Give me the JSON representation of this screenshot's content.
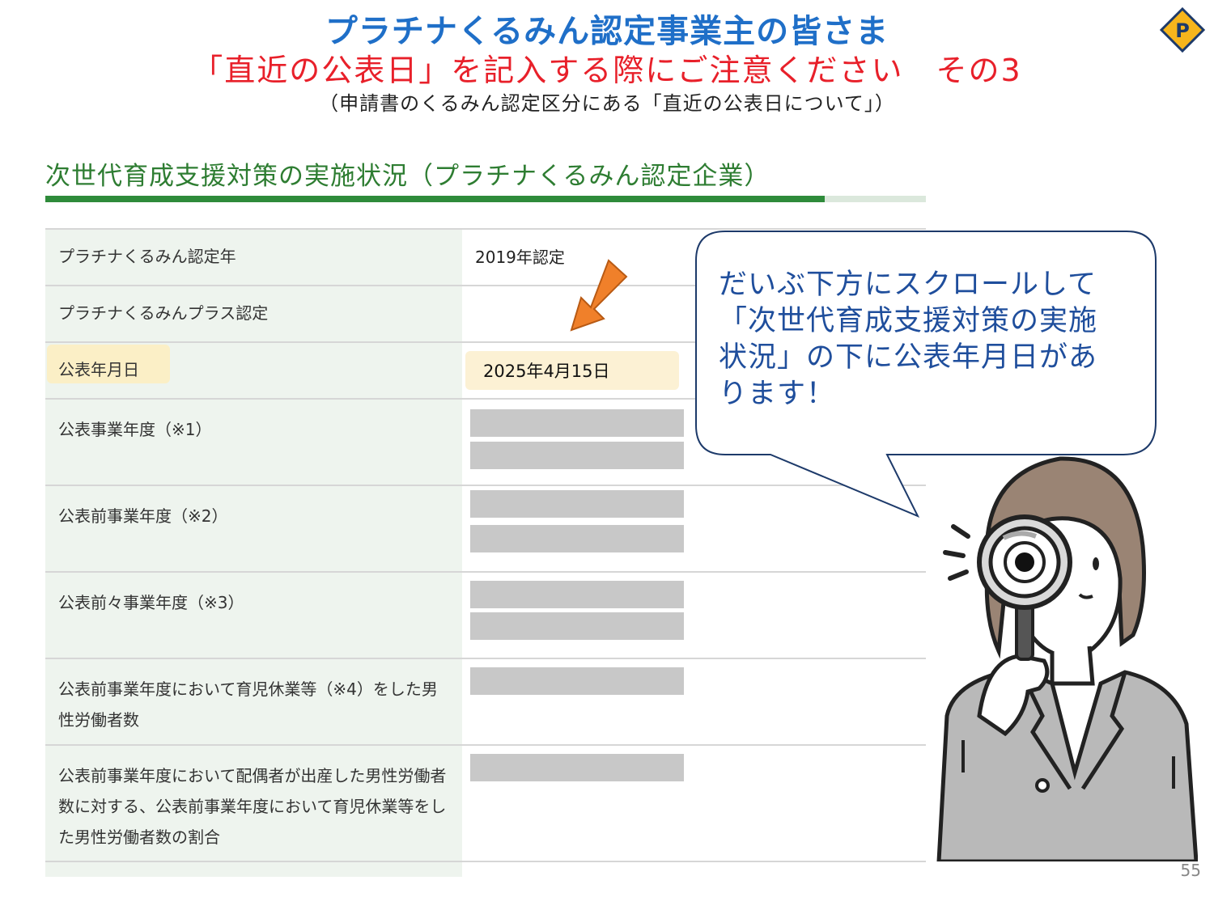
{
  "slide": {
    "title_line1": "プラチナくるみん認定事業主の皆さま",
    "title_line2": "「直近の公表日」を記入する際にご注意ください　その3",
    "title_line3": "（申請書のくるみん認定区分にある「直近の公表日について」）",
    "badge_letter": "P",
    "page_number": "55",
    "accent_blue": "#1f6fc8",
    "accent_red": "#e8202a"
  },
  "section": {
    "heading": "次世代育成支援対策の実施状況（プラチナくるみん認定企業）",
    "heading_color": "#2e7d32"
  },
  "table": {
    "rows": [
      {
        "label": "プラチナくるみん認定年",
        "value": "2019年認定"
      },
      {
        "label": "プラチナくるみんプラス認定",
        "value": ""
      },
      {
        "label": "公表年月日",
        "value": "2025年4月15日"
      },
      {
        "label": "公表事業年度（※1）",
        "value": ""
      },
      {
        "label": "公表前事業年度（※2）",
        "value": ""
      },
      {
        "label": "公表前々事業年度（※3）",
        "value": ""
      },
      {
        "label": "公表前事業年度において育児休業等（※4）をした男性労働者数",
        "value": ""
      },
      {
        "label": "公表前事業年度において配偶者が出産した男性労働者数に対する、公表前事業年度において育児休業等をした男性労働者数の割合",
        "value": ""
      }
    ]
  },
  "callout": {
    "text": "だいぶ下方にスクロールして「次世代育成支援対策の実施状況」の下に公表年月日があります！",
    "text_color": "#1f4e9c"
  },
  "icons": {
    "arrow": "orange-down-left-arrow-icon",
    "badge": "p-diamond-badge-icon",
    "illustration": "woman-with-magnifier-icon"
  }
}
